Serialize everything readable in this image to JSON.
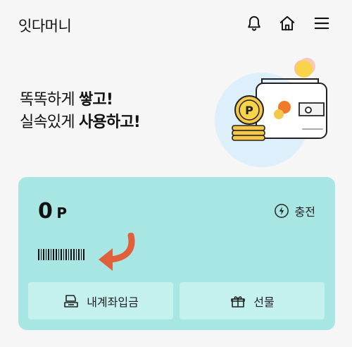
{
  "header": {
    "title": "잇다머니",
    "icons": [
      "bell-icon",
      "home-icon",
      "menu-icon"
    ]
  },
  "hero": {
    "line1_regular": "똑똑하게 ",
    "line1_bold": "쌓고!",
    "line2_regular": "실속있게 ",
    "line2_bold": "사용하고!",
    "coin_letter": "P"
  },
  "card": {
    "points_value": "0",
    "points_unit": "P",
    "charge_label": "충전",
    "buttons": [
      {
        "label": "내계좌입금",
        "icon": "bank-deposit-icon"
      },
      {
        "label": "선물",
        "icon": "gift-icon"
      }
    ]
  },
  "colors": {
    "card_bg": "#a7e6e2",
    "button_bg": "#c4f0ee",
    "arrow": "#e0603c",
    "coin": "#f5c84a"
  }
}
